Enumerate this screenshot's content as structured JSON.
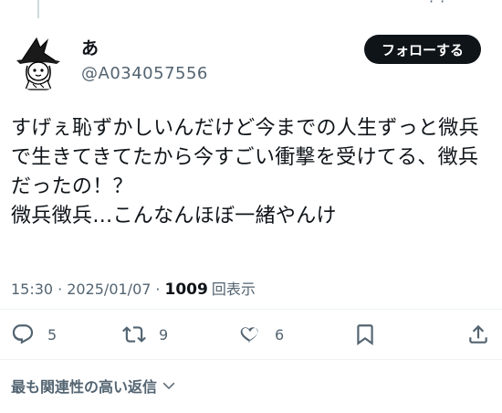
{
  "author": {
    "display_name": "あ",
    "handle": "@A034057556"
  },
  "follow_button_label": "フォローする",
  "tweet": {
    "text": "すげぇ恥ずかしいんだけど今までの人生ずっと微兵\nで生きてきてたから今すごい衝撃を受けてる、徴兵\nだったの！？\n微兵徴兵…こんなんほぼ一緒やんけ",
    "time": "15:30",
    "separator": "·",
    "date": "2025/01/07",
    "views_count": "1009",
    "views_label": "回表示"
  },
  "actions": {
    "reply_count": "5",
    "retweet_count": "9",
    "like_count": "6"
  },
  "replies_sort_label": "最も関連性の高い返信",
  "icons": {
    "reply": "reply-icon",
    "retweet": "retweet-icon",
    "like": "like-icon",
    "bookmark": "bookmark-icon",
    "share": "share-icon",
    "sort": "chevron-down-icon"
  },
  "colors": {
    "text_primary": "#0f1419",
    "text_secondary": "#536471",
    "button_bg": "#0f1419",
    "button_text": "#ffffff",
    "divider": "#eff3f4"
  }
}
